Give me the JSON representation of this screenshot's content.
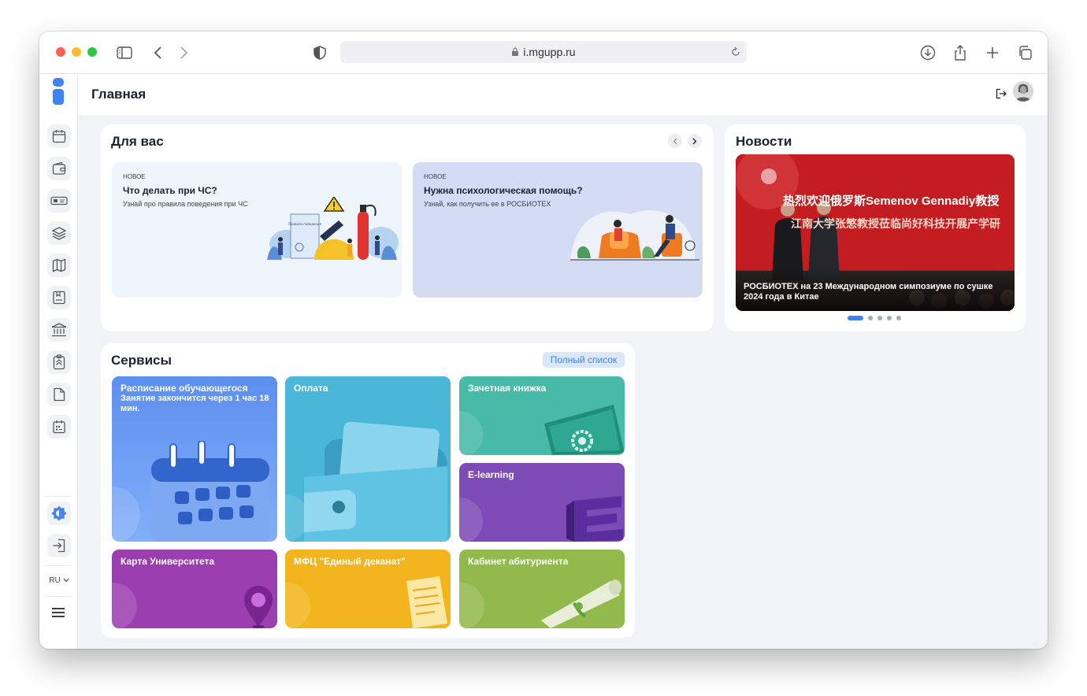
{
  "browser": {
    "url": "i.mgupp.ru"
  },
  "header": {
    "title": "Главная"
  },
  "sidebar": {
    "lang": "RU"
  },
  "for_you": {
    "title": "Для вас",
    "cards": [
      {
        "tag": "НОВОЕ",
        "title": "Что делать при ЧС?",
        "subtitle": "Узнай про правила поведения при ЧС",
        "poster": "Правила поведения"
      },
      {
        "tag": "НОВОЕ",
        "title": "Нужна психологическая помощь?",
        "subtitle": "Узнай, как получить ее в РОСБИОТЕХ"
      }
    ]
  },
  "news": {
    "title": "Новости",
    "caption": "РОСБИОТЕХ на 23 Международном симпозиуме по сушке 2024 года в Китае",
    "banner_line1": "热烈欢迎俄罗斯Semenov Gennadiy教授",
    "banner_line2": "江南大学张慜教授莅临尚好科技开展产学研"
  },
  "services": {
    "title": "Сервисы",
    "full_list": "Полный список",
    "items": [
      {
        "label": "Расписание обучающегося",
        "sub": "Занятие закончится через 1 час 18 мин."
      },
      {
        "label": "Оплата"
      },
      {
        "label": "Зачетная книжка"
      },
      {
        "label": "E-learning"
      },
      {
        "label": "Карта Университета"
      },
      {
        "label": "МФЦ \"Единый деканат\""
      },
      {
        "label": "Кабинет абитуриента"
      }
    ]
  },
  "colors": {
    "accent": "#3e83f0",
    "link_bg": "#dbe8fb"
  }
}
